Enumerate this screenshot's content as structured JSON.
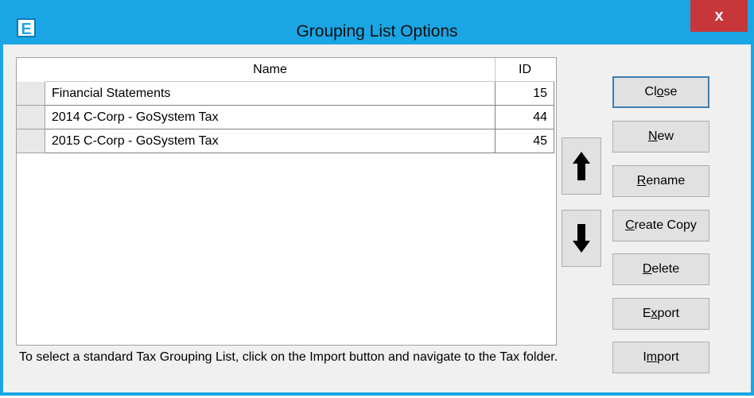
{
  "window": {
    "app_icon_letter": "E",
    "title": "Grouping List Options",
    "close_glyph": "x"
  },
  "grid": {
    "columns": [
      "Name",
      "ID"
    ],
    "rows": [
      {
        "name": "Financial Statements",
        "id": "15"
      },
      {
        "name": "2014 C-Corp - GoSystem Tax",
        "id": "44"
      },
      {
        "name": "2015 C-Corp - GoSystem Tax",
        "id": "45"
      }
    ]
  },
  "buttons": {
    "close": {
      "pre": "Cl",
      "u": "o",
      "post": "se"
    },
    "new": {
      "pre": "",
      "u": "N",
      "post": "ew"
    },
    "rename": {
      "pre": "",
      "u": "R",
      "post": "ename"
    },
    "create_copy": {
      "pre": "",
      "u": "C",
      "post": "reate Copy"
    },
    "delete": {
      "pre": "",
      "u": "D",
      "post": "elete"
    },
    "export": {
      "pre": "E",
      "u": "x",
      "post": "port"
    },
    "import": {
      "pre": "I",
      "u": "m",
      "post": "port"
    }
  },
  "icons": {
    "move_up": "arrow-up-icon",
    "move_down": "arrow-down-icon"
  },
  "hint": "To select a standard Tax Grouping List, click on the Import button and navigate to the Tax folder.",
  "colors": {
    "titlebar": "#1aa6e4",
    "close_button": "#c7373a"
  }
}
